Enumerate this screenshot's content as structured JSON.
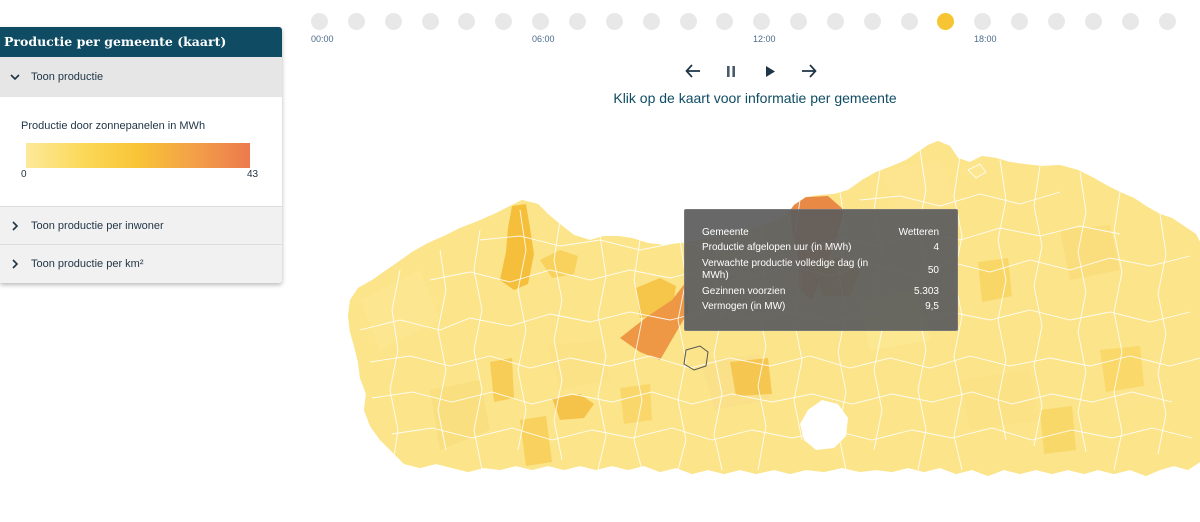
{
  "panel": {
    "title": "Productie per gemeente (kaart)",
    "sections": [
      {
        "label": "Toon productie",
        "expanded": true
      },
      {
        "label": "Toon productie per inwoner",
        "expanded": false
      },
      {
        "label": "Toon productie per km²",
        "expanded": false
      }
    ],
    "legend": {
      "title": "Productie door zonnepanelen in MWh",
      "min": "0",
      "max": "43",
      "colors": [
        "#fde99a",
        "#f9c436",
        "#ec7a4d"
      ]
    }
  },
  "timeline": {
    "hours": 24,
    "active_index": 17,
    "labels": [
      "00:00",
      "06:00",
      "12:00",
      "18:00"
    ],
    "active_color": "#f7c534",
    "inactive_color": "#e8e8e8"
  },
  "controls": {
    "icons": [
      "arrow-left-icon",
      "pause-icon",
      "play-icon",
      "arrow-right-icon"
    ]
  },
  "instruction": "Klik op de kaart voor informatie per gemeente",
  "tooltip": {
    "header_key": "Gemeente",
    "header_value": "Wetteren",
    "rows": [
      {
        "key": "Productie afgelopen uur (in MWh)",
        "value": "4"
      },
      {
        "key": "Verwachte productie volledige dag (in MWh)",
        "value": "50"
      },
      {
        "key": "Gezinnen voorzien",
        "value": "5.303"
      },
      {
        "key": "Vermogen (in MW)",
        "value": "9,5"
      }
    ]
  },
  "map": {
    "region": "Vlaanderen",
    "base_color": "#fbe48a",
    "border_color": "#ffffff"
  }
}
